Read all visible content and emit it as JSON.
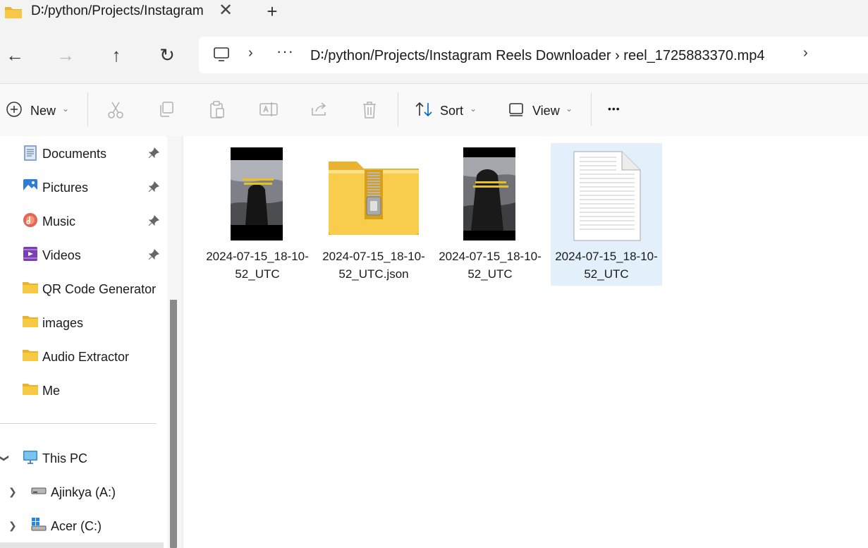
{
  "tab": {
    "title": "D∶/python/Projects/Instagram Reels Downloader",
    "close_glyph": "✕",
    "new_tab_glyph": "+",
    "folder_icon": "folder-icon"
  },
  "nav": {
    "back_glyph": "←",
    "forward_glyph": "→",
    "up_glyph": "↑",
    "refresh_glyph": "↻"
  },
  "address": {
    "chevron": "›",
    "more": "···",
    "path": "D∶/python/Projects/Instagram Reels Downloader › reel_1725883370.mp4",
    "chevron_end": "›"
  },
  "toolbar": {
    "new_label": "New",
    "sort_label": "Sort",
    "view_label": "View",
    "dropdown_glyph": "⌄",
    "more_glyph": "•••",
    "icons": [
      "cut-icon",
      "copy-icon",
      "paste-icon",
      "rename-icon",
      "share-icon",
      "delete-icon"
    ]
  },
  "sidebar": {
    "quick_access": [
      {
        "label": "Documents",
        "icon": "documents-icon",
        "pinned": true
      },
      {
        "label": "Pictures",
        "icon": "pictures-icon",
        "pinned": true
      },
      {
        "label": "Music",
        "icon": "music-icon",
        "pinned": true
      },
      {
        "label": "Videos",
        "icon": "videos-icon",
        "pinned": true
      },
      {
        "label": "QR Code Generator",
        "icon": "folder-icon",
        "pinned": false
      },
      {
        "label": "images",
        "icon": "folder-icon",
        "pinned": false
      },
      {
        "label": "Audio Extractor",
        "icon": "folder-icon",
        "pinned": false
      },
      {
        "label": "Me",
        "icon": "folder-icon",
        "pinned": false
      }
    ],
    "this_pc": {
      "label": "This PC",
      "icon": "computer-icon"
    },
    "drives": [
      {
        "label": "Ajinkya (A:)",
        "icon": "drive-icon"
      },
      {
        "label": "Acer (C:)",
        "icon": "windows-drive-icon"
      }
    ]
  },
  "files": [
    {
      "name": "2024-07-15_18-10-52_UTC",
      "type": "video-thumbnail",
      "caption": "Rishta aaya Kharab Engineering graduate se",
      "selected": false
    },
    {
      "name": "2024-07-15_18-10-52_UTC.json",
      "type": "zip-folder",
      "selected": false
    },
    {
      "name": "2024-07-15_18-10-52_UTC",
      "type": "image-thumbnail",
      "caption": "Rishta aaya Kharab Engineering graduate se",
      "selected": false
    },
    {
      "name": "2024-07-15_18-10-52_UTC",
      "type": "text-document",
      "selected": true
    }
  ],
  "colors": {
    "accent": "#0067c0",
    "selection": "#e3f0fc",
    "folder": "#f7c844"
  }
}
